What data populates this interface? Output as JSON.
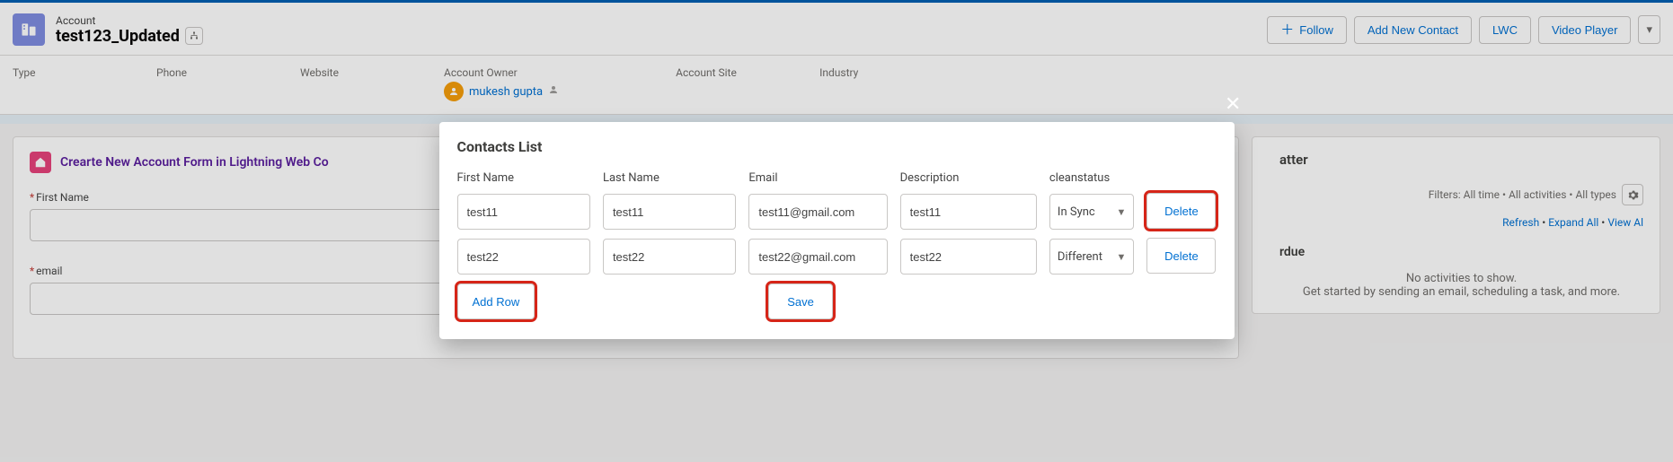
{
  "header": {
    "object_label": "Account",
    "record_name": "test123_Updated",
    "actions": {
      "follow": "Follow",
      "add_contact": "Add New Contact",
      "lwc": "LWC",
      "video": "Video Player"
    }
  },
  "highlights": {
    "labels": {
      "type": "Type",
      "phone": "Phone",
      "website": "Website",
      "owner": "Account Owner",
      "site": "Account Site",
      "industry": "Industry"
    },
    "owner_name": "mukesh gupta"
  },
  "main": {
    "card_title": "Crearte New Account Form in Lightning Web Co",
    "fields": {
      "first_name_label": "First Name",
      "email_label": "email"
    }
  },
  "chatter": {
    "tab": "atter",
    "filters": "Filters: All time • All activities • All types",
    "links": {
      "refresh": "Refresh",
      "expand": "Expand All",
      "view": "View Al"
    },
    "section": "rdue",
    "empty1": "No activities to show.",
    "empty2": "Get started by sending an email, scheduling a task, and more."
  },
  "modal": {
    "title": "Contacts List",
    "columns": {
      "first_name": "First Name",
      "last_name": "Last Name",
      "email": "Email",
      "description": "Description",
      "cleanstatus": "cleanstatus",
      "delete": "Delete"
    },
    "rows": [
      {
        "first_name": "test11",
        "last_name": "test11",
        "email": "test11@gmail.com",
        "description": "test11",
        "cleanstatus": "In Sync"
      },
      {
        "first_name": "test22",
        "last_name": "test22",
        "email": "test22@gmail.com",
        "description": "test22",
        "cleanstatus": "Different"
      }
    ],
    "buttons": {
      "add_row": "Add Row",
      "save": "Save"
    }
  }
}
